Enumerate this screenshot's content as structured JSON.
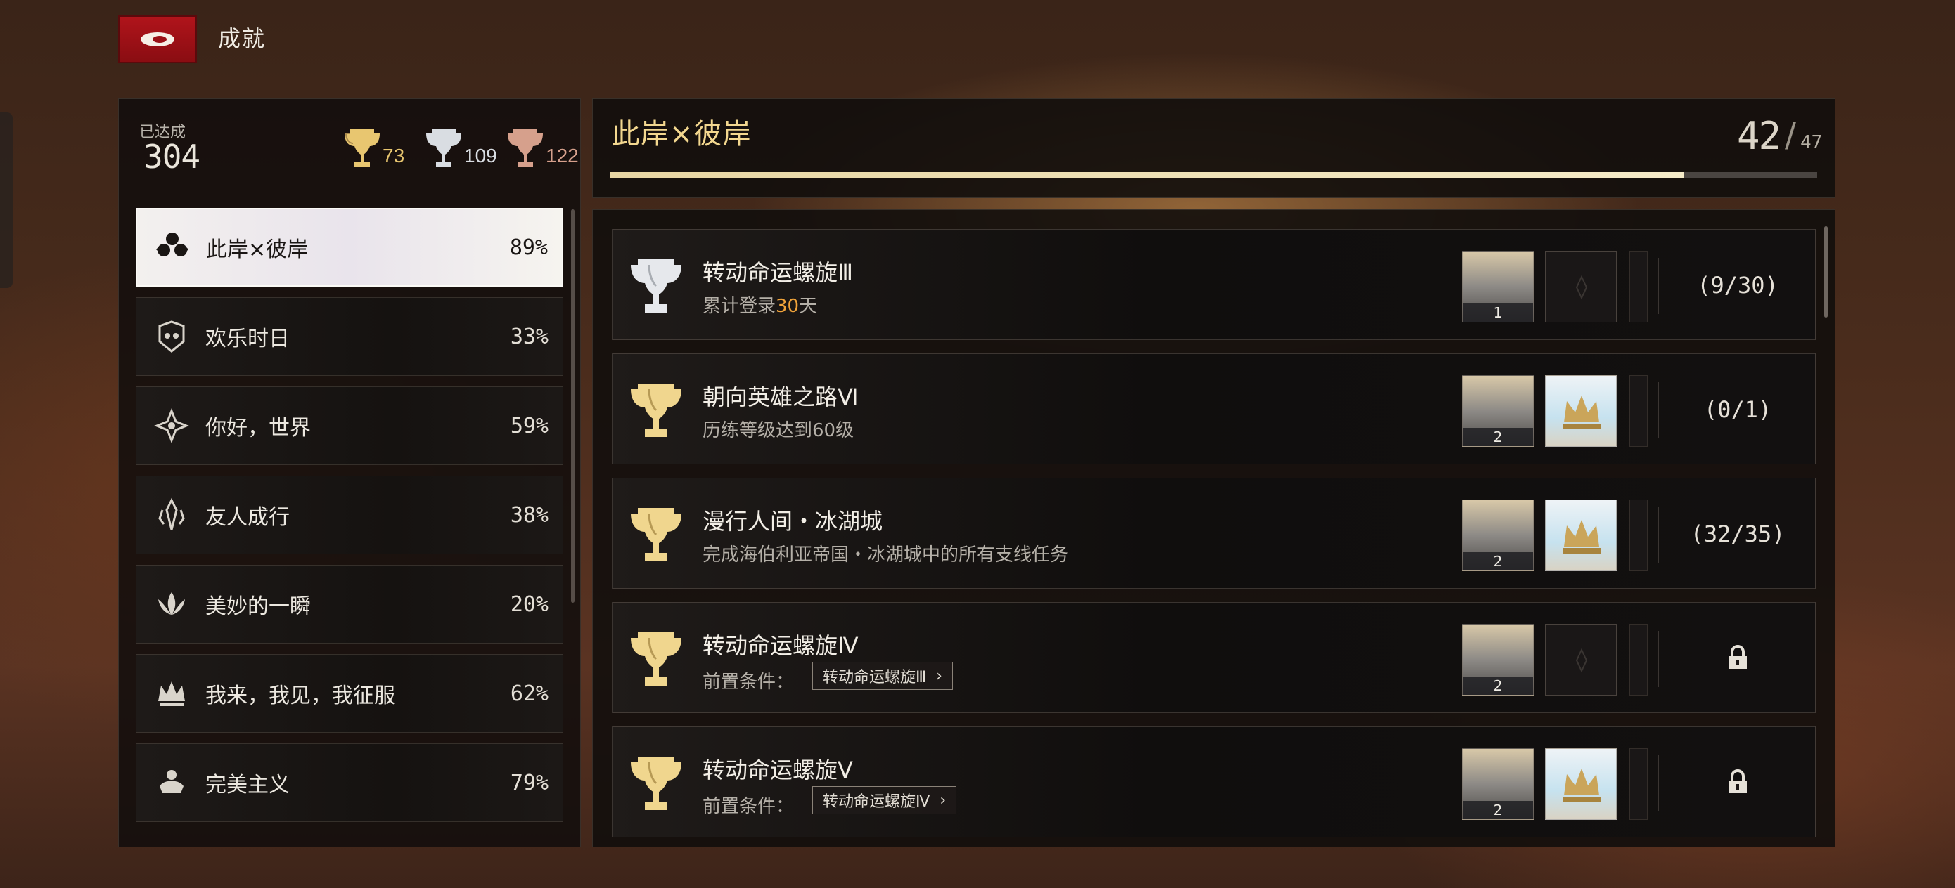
{
  "header": {
    "title": "成就"
  },
  "summary": {
    "achieved_label": "已达成",
    "achieved_count": "304",
    "gold_count": "73",
    "silver_count": "109",
    "bronze_count": "122",
    "colors": {
      "gold": "#e8c670",
      "silver": "#d9dde2",
      "bronze": "#d6a08c"
    }
  },
  "categories": [
    {
      "name": "此岸×彼岸",
      "pct": "89%",
      "icon": "cloverleaf-icon",
      "active": true
    },
    {
      "name": "欢乐时日",
      "pct": "33%",
      "icon": "mask-icon"
    },
    {
      "name": "你好，世界",
      "pct": "59%",
      "icon": "eye-emblem-icon"
    },
    {
      "name": "友人成行",
      "pct": "38%",
      "icon": "figures-icon"
    },
    {
      "name": "美妙的一瞬",
      "pct": "20%",
      "icon": "lotus-icon"
    },
    {
      "name": "我来，我见，我征服",
      "pct": "62%",
      "icon": "crown-icon"
    },
    {
      "name": "完美主义",
      "pct": "79%",
      "icon": "flower-crown-icon"
    }
  ],
  "section": {
    "title": "此岸×彼岸",
    "count": "42",
    "total": "47",
    "progress": 0.89
  },
  "achievements": [
    {
      "title": "转动命运螺旋Ⅲ",
      "desc_pre": "累计登录",
      "desc_hl": "30",
      "desc_post": "天",
      "trophy": "silver",
      "reward_qty": "1",
      "has_crown": false,
      "progress": "(9/30)",
      "locked": false
    },
    {
      "title": "朝向英雄之路Ⅵ",
      "desc": "历练等级达到60级",
      "trophy": "gold",
      "reward_qty": "2",
      "has_crown": true,
      "progress": "(0/1)",
      "locked": false
    },
    {
      "title": "漫行人间・冰湖城",
      "desc": "完成海伯利亚帝国・冰湖城中的所有支线任务",
      "trophy": "gold",
      "reward_qty": "2",
      "has_crown": true,
      "progress": "(32/35)",
      "locked": false
    },
    {
      "title": "转动命运螺旋Ⅳ",
      "prereq_label": "前置条件：",
      "prereq": "转动命运螺旋Ⅲ",
      "trophy": "gold",
      "reward_qty": "2",
      "has_crown": false,
      "locked": true
    },
    {
      "title": "转动命运螺旋Ⅴ",
      "prereq_label": "前置条件：",
      "prereq": "转动命运螺旋Ⅳ",
      "trophy": "gold",
      "reward_qty": "2",
      "has_crown": true,
      "locked": true
    }
  ]
}
